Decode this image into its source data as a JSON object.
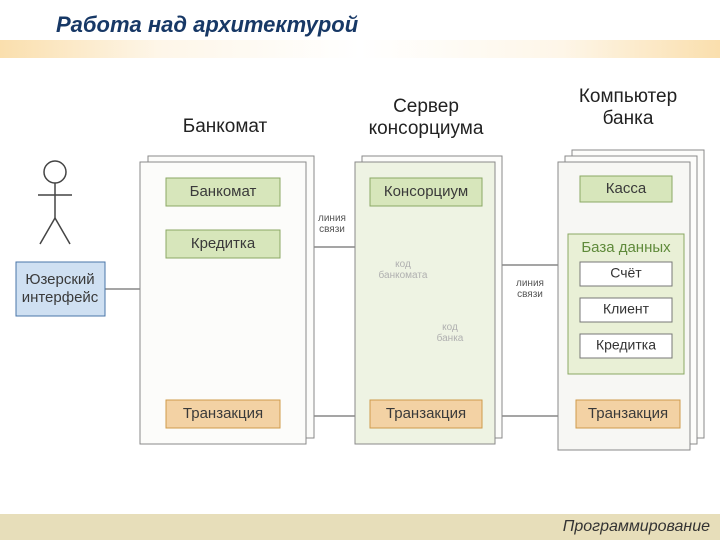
{
  "title": "Работа над архитектурой",
  "footer": "Программирование",
  "captions": {
    "atm": "Банкомат",
    "consortium": "Сервер\nконсорциума",
    "bank": "Компьютер\nбанка"
  },
  "nodes": {
    "ui": "Юзерский\nинтерфейс",
    "atm": "Банкомат",
    "card": "Кредитка",
    "consortium": "Консорциум",
    "cash": "Касса",
    "db": "База данных",
    "account": "Счёт",
    "client": "Клиент",
    "db_card": "Кредитка",
    "tx_atm": "Транзакция",
    "tx_cons": "Транзакция",
    "tx_bank": "Транзакция"
  },
  "labels": {
    "link1": "линия\nсвязи",
    "link2": "линия\nсвязи",
    "code_atm": "код\nбанкомата",
    "code_bank": "код\nбанка"
  },
  "colors": {
    "container_stroke": "#8a8a8a",
    "container_fill": "#fcfcfa",
    "ui_fill": "#cfe0f2",
    "ui_stroke": "#4a76a8",
    "green_fill": "#d7e6bb",
    "green_stroke": "#8ba864",
    "orange_fill": "#f3d2a4",
    "orange_stroke": "#cf9b4b",
    "pale_fill": "#eef3e3",
    "bank_fill": "#f7f7f4",
    "db_fill": "#e9f0d6",
    "inner_fill": "#ffffff"
  }
}
